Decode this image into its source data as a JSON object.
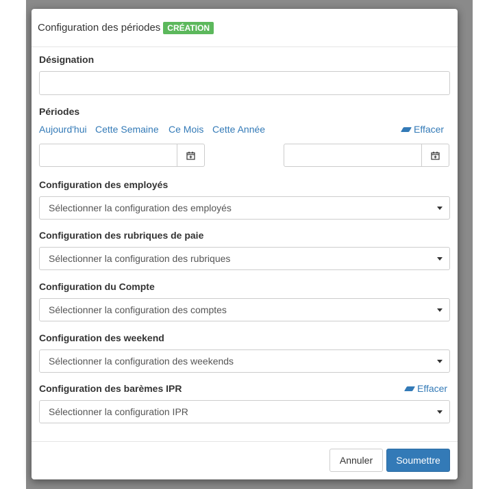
{
  "modal": {
    "title": "Configuration des périodes",
    "badge": "CRÉATION"
  },
  "designation": {
    "label": "Désignation",
    "value": ""
  },
  "periods": {
    "label": "Périodes",
    "quick_links": [
      "Aujourd'hui",
      "Cette Semaine",
      "Ce Mois",
      "Cette Année"
    ],
    "clear_label": "Effacer",
    "start_value": "",
    "end_value": ""
  },
  "employees": {
    "label": "Configuration des employés",
    "placeholder": "Sélectionner la configuration des employés"
  },
  "pay_items": {
    "label": "Configuration des rubriques de paie",
    "placeholder": "Sélectionner la configuration des rubriques"
  },
  "account": {
    "label": "Configuration du Compte",
    "placeholder": "Sélectionner la configuration des comptes"
  },
  "weekend": {
    "label": "Configuration des weekend",
    "placeholder": "Sélectionner la configuration des weekends"
  },
  "ipr": {
    "label": "Configuration des barèmes IPR",
    "placeholder": "Sélectionner la configuration IPR",
    "clear_label": "Effacer"
  },
  "footer": {
    "cancel_label": "Annuler",
    "submit_label": "Soumettre"
  },
  "colors": {
    "badge": "#5cb85c",
    "link": "#337ab7",
    "primary": "#337ab7"
  },
  "icons": [
    "calendar-icon",
    "eraser-icon",
    "caret-down-icon"
  ]
}
